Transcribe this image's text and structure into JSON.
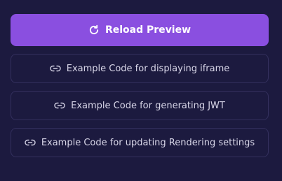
{
  "buttons": {
    "reload": {
      "label": "Reload Preview",
      "icon": "reload-icon"
    },
    "examples": [
      {
        "label": "Example Code for displaying iframe",
        "icon": "link-icon"
      },
      {
        "label": "Example Code for generating JWT",
        "icon": "link-icon"
      },
      {
        "label": "Example Code for updating Rendering settings",
        "icon": "link-icon"
      }
    ]
  },
  "colors": {
    "background": "#1c1a3f",
    "primary": "#8a4fe0",
    "outline_border": "#34305e",
    "outline_text": "#d8d6e8"
  }
}
